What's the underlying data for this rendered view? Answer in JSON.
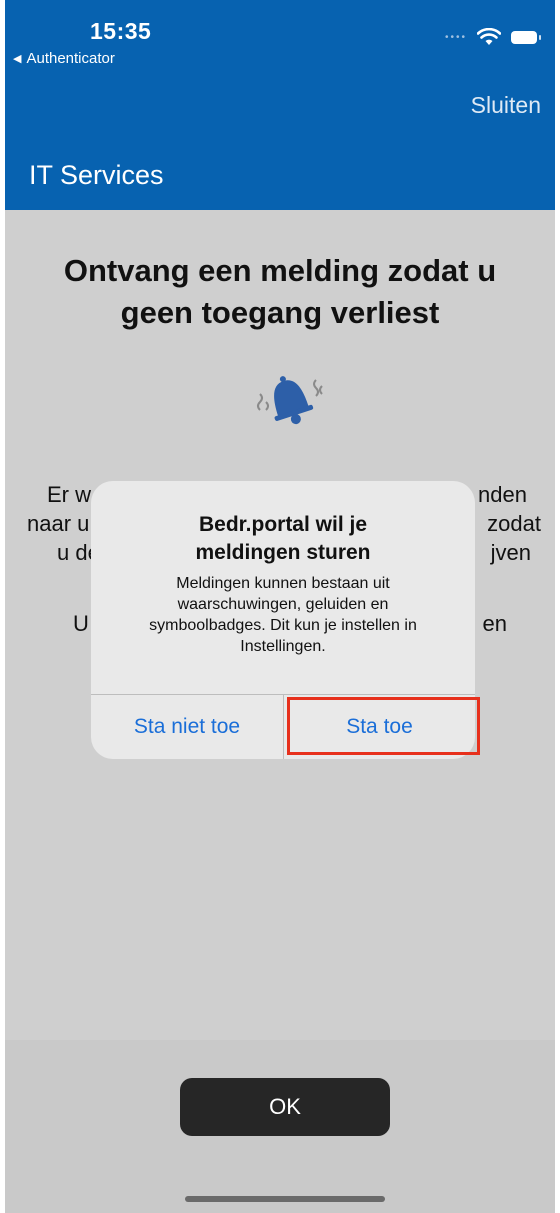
{
  "status_bar": {
    "time": "15:35",
    "back_app": "Authenticator"
  },
  "header": {
    "close_label": "Sluiten",
    "title": "IT Services"
  },
  "content": {
    "title_line1": "Ontvang een melding zodat u",
    "title_line2": "geen toegang verliest",
    "partial_lines": {
      "l1_left": "Er w",
      "l1_right": "nden",
      "l2_left": "naar u",
      "l2_right": "zodat",
      "l3_left": "u de",
      "l3_right": "jven",
      "l4_left": "U",
      "l4_right": "en"
    }
  },
  "alert": {
    "title_line1": "Bedr.portal wil je",
    "title_line2": "meldingen sturen",
    "message_line1": "Meldingen kunnen bestaan uit",
    "message_line2": "waarschuwingen, geluiden en",
    "message_line3": "symboolbadges. Dit kun je instellen in",
    "message_line4": "Instellingen.",
    "deny_label": "Sta niet toe",
    "allow_label": "Sta toe"
  },
  "footer": {
    "ok_label": "OK"
  },
  "colors": {
    "header_blue": "#0762b0",
    "alert_button_blue": "#1a6ed8",
    "highlight_red": "#e7301c",
    "ok_button_bg": "#262626"
  },
  "icons": [
    "back-arrow-icon",
    "wifi-icon",
    "battery-icon",
    "bell-icon"
  ]
}
